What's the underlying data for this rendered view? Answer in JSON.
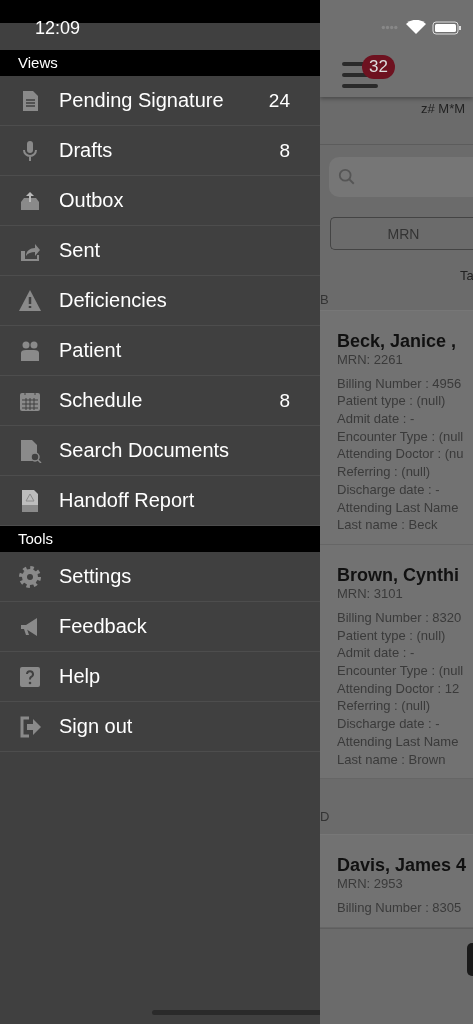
{
  "status_bar": {
    "time": "12:09"
  },
  "drawer": {
    "sections": [
      {
        "title": "Views",
        "items": [
          {
            "label": "Pending Signature",
            "count": "24"
          },
          {
            "label": "Drafts",
            "count": "8"
          },
          {
            "label": "Outbox"
          },
          {
            "label": "Sent"
          },
          {
            "label": "Deficiencies"
          },
          {
            "label": "Patient"
          },
          {
            "label": "Schedule",
            "count": "8"
          },
          {
            "label": "Search Documents"
          },
          {
            "label": "Handoff Report"
          }
        ]
      },
      {
        "title": "Tools",
        "items": [
          {
            "label": "Settings"
          },
          {
            "label": "Feedback"
          },
          {
            "label": "Help"
          },
          {
            "label": "Sign out"
          }
        ]
      }
    ]
  },
  "main": {
    "menu_badge": "32",
    "header_text": "z# M*M",
    "filter_button": "MRN",
    "tab_label": "Ta",
    "groups": [
      {
        "letter": "B",
        "patients": [
          {
            "name": "Beck, Janice ,",
            "mrn": "MRN: 2261",
            "details": [
              "Billing Number : 4956",
              "Patient type : (null)",
              "Admit date : -",
              "Encounter Type : (null",
              "Attending Doctor : (nu",
              "Referring : (null)",
              "Discharge date : -",
              "Attending Last Name",
              "Last name : Beck"
            ]
          },
          {
            "name": "Brown, Cynthi",
            "mrn": "MRN: 3101",
            "details": [
              "Billing Number : 8320",
              "Patient type : (null)",
              "Admit date : -",
              "Encounter Type : (null",
              "Attending Doctor : 12",
              "Referring : (null)",
              "Discharge date : -",
              "Attending Last Name",
              "Last name : Brown"
            ]
          }
        ]
      },
      {
        "letter": "D",
        "patients": [
          {
            "name": "Davis, James 4",
            "mrn": "MRN: 2953",
            "details": [
              "Billing Number : 8305"
            ]
          }
        ]
      }
    ]
  }
}
